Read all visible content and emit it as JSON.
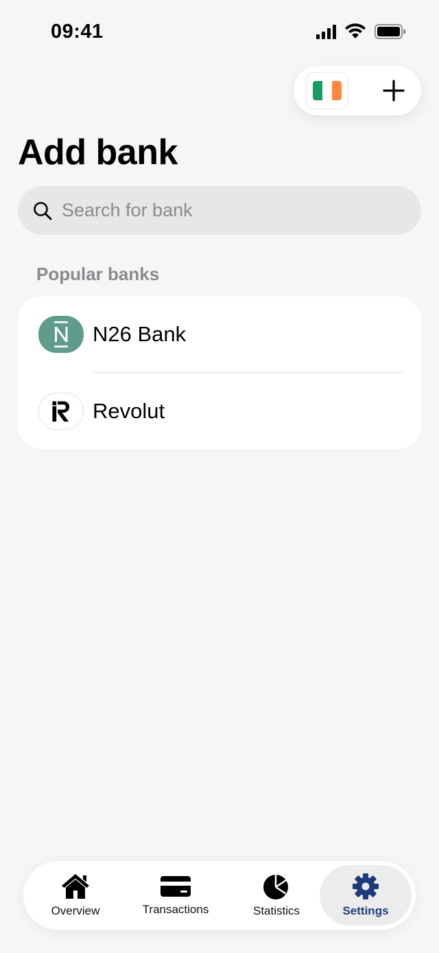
{
  "status_bar": {
    "time": "09:41"
  },
  "header": {
    "flag_icon": "ireland-flag-icon",
    "add_icon": "plus-icon"
  },
  "page": {
    "title": "Add bank"
  },
  "search": {
    "placeholder": "Search for bank",
    "value": ""
  },
  "popular": {
    "label": "Popular banks",
    "banks": [
      {
        "name": "N26 Bank",
        "logo": "n26-logo",
        "logo_color": "#5f9c8b"
      },
      {
        "name": "Revolut",
        "logo": "revolut-logo",
        "logo_color": "#000000"
      }
    ]
  },
  "tabbar": {
    "tabs": [
      {
        "label": "Overview",
        "icon": "home-icon",
        "active": false
      },
      {
        "label": "Transactions",
        "icon": "card-icon",
        "active": false
      },
      {
        "label": "Statistics",
        "icon": "pie-chart-icon",
        "active": false
      },
      {
        "label": "Settings",
        "icon": "gear-icon",
        "active": true
      }
    ],
    "accent": "#1f3a7a"
  }
}
